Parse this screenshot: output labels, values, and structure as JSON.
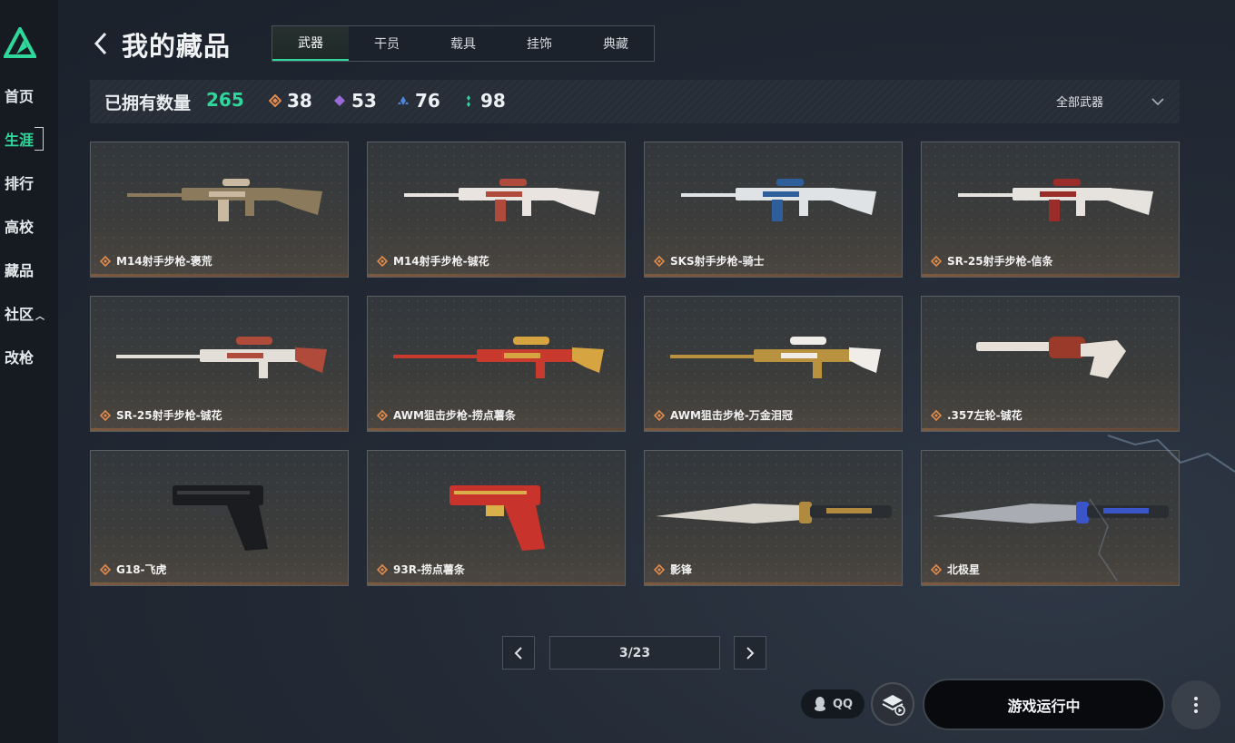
{
  "nav": {
    "items": [
      {
        "label": "首页"
      },
      {
        "label": "生涯"
      },
      {
        "label": "排行"
      },
      {
        "label": "高校"
      },
      {
        "label": "藏品"
      },
      {
        "label": "社区"
      },
      {
        "label": "改枪"
      }
    ],
    "active_index": 1
  },
  "header": {
    "title": "我的藏品",
    "tabs": [
      "武器",
      "干员",
      "载具",
      "挂饰",
      "典藏"
    ],
    "active_tab": 0
  },
  "stats": {
    "owned_label": "已拥有数量",
    "owned_count": "265",
    "rarities": [
      {
        "count": "38",
        "color": "#e08a4e",
        "icon": "orange-diamond-icon"
      },
      {
        "count": "53",
        "color": "#9a6bd8",
        "icon": "purple-diamond-icon"
      },
      {
        "count": "76",
        "color": "#4f86d8",
        "icon": "blue-diamond-icon"
      },
      {
        "count": "98",
        "color": "#2fd79a",
        "icon": "green-diamond-icon"
      }
    ],
    "filter": "全部武器"
  },
  "items": [
    {
      "name": "M14射手步枪-褒荒",
      "kind": "rifle",
      "colors": [
        "#8c7a5d",
        "#c9b9a0"
      ]
    },
    {
      "name": "M14射手步枪-铖花",
      "kind": "rifle",
      "colors": [
        "#e9e4df",
        "#b04a3a"
      ]
    },
    {
      "name": "SKS射手步枪-骑士",
      "kind": "rifle",
      "colors": [
        "#dfe3e6",
        "#2f5f9a"
      ]
    },
    {
      "name": "SR-25射手步枪-信条",
      "kind": "rifle",
      "colors": [
        "#e6e3de",
        "#9a2c2a"
      ]
    },
    {
      "name": "SR-25射手步枪-铖花",
      "kind": "sniper",
      "colors": [
        "#e3ded7",
        "#b04a3a"
      ]
    },
    {
      "name": "AWM狙击步枪-捞点薯条",
      "kind": "sniper",
      "colors": [
        "#c83a2e",
        "#d6a542"
      ]
    },
    {
      "name": "AWM狙击步枪-万金泪冠",
      "kind": "sniper",
      "colors": [
        "#b8923e",
        "#f0ede8"
      ]
    },
    {
      "name": ".357左轮-铖花",
      "kind": "revolver",
      "colors": [
        "#e6e0d8",
        "#9a3a2a"
      ]
    },
    {
      "name": "G18-飞虎",
      "kind": "pistol",
      "colors": [
        "#1b1c1f",
        "#3a3c40"
      ]
    },
    {
      "name": "93R-捞点薯条",
      "kind": "pistol",
      "colors": [
        "#c8342b",
        "#d9b04a"
      ]
    },
    {
      "name": "影锋",
      "kind": "knife",
      "colors": [
        "#d8d4cc",
        "#b08a3e"
      ]
    },
    {
      "name": "北极星",
      "kind": "knife",
      "colors": [
        "#a9adb3",
        "#3a55c8"
      ]
    }
  ],
  "pagination": {
    "current": "3/23"
  },
  "bottom": {
    "qq_label": "QQ",
    "launch_label": "游戏运行中"
  }
}
